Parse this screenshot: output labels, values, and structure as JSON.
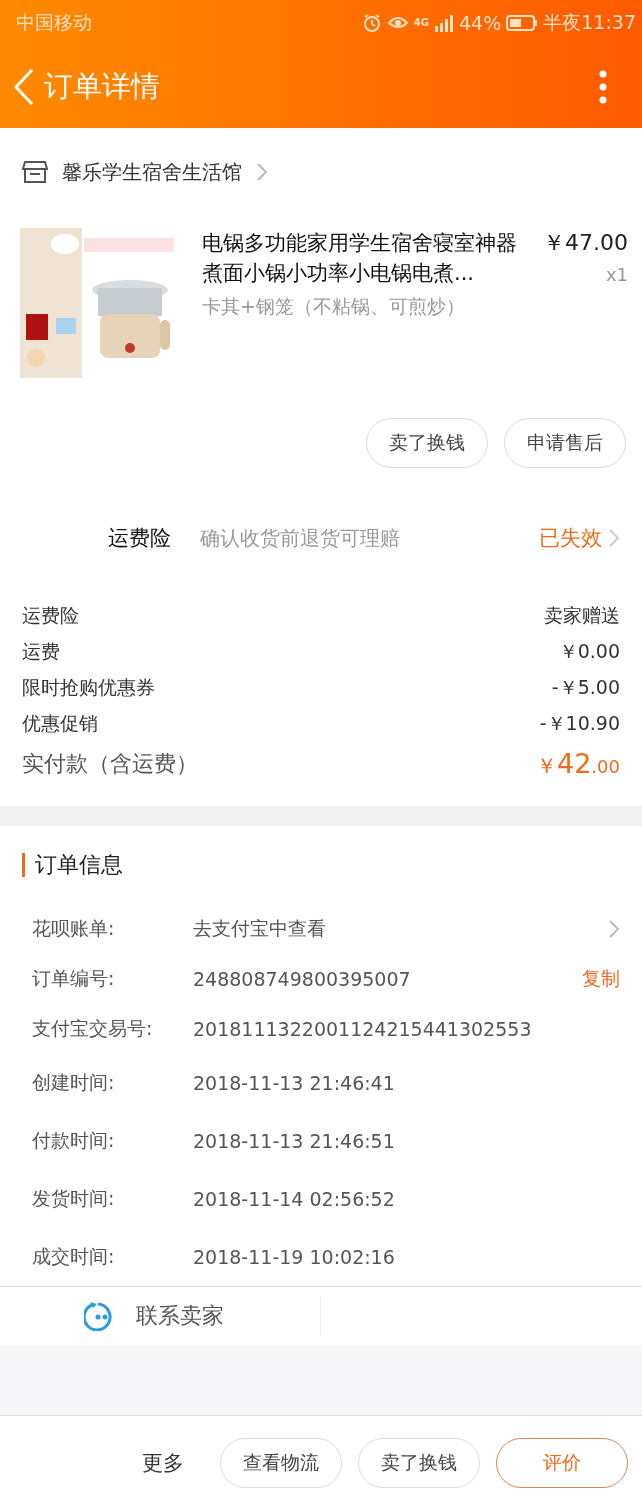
{
  "status_bar": {
    "carrier": "中国移动",
    "network": "4G",
    "battery": "44%",
    "time": "半夜11:37"
  },
  "header": {
    "title": "订单详情"
  },
  "shop": {
    "name": "馨乐学生宿舍生活馆"
  },
  "product": {
    "kind": "picture",
    "title": "电锅多功能家用学生宿舍寝室神器煮面小锅小功率小电锅电煮...",
    "price": "￥47.00",
    "quantity": "x1",
    "sku": "卡其+钢笼（不粘锅、可煎炒）"
  },
  "item_actions": [
    "卖了换钱",
    "申请售后"
  ],
  "insurance": {
    "label": "运费险",
    "description": "确认收货前退货可理赔",
    "status": "已失效"
  },
  "price_rows": [
    {
      "kind": "line",
      "label": "运费险",
      "value": "卖家赠送"
    },
    {
      "kind": "line",
      "label": "运费",
      "value": "￥0.00"
    },
    {
      "kind": "line",
      "label": "限时抢购优惠券",
      "value": "-￥5.00"
    },
    {
      "kind": "line",
      "label": "优惠促销",
      "value": "-￥10.90"
    },
    {
      "kind": "total",
      "label": "实付款（含运费）",
      "currency": "￥",
      "value": "42",
      "decimals": ".00"
    }
  ],
  "order_info": {
    "title": "订单信息",
    "rows": [
      {
        "kind": "link",
        "label": "花呗账单:",
        "value": "去支付宝中查看"
      },
      {
        "kind": "copy",
        "label": "订单编号:",
        "value": "248808749800395007",
        "action": "复制"
      },
      {
        "kind": "plain",
        "label": "支付宝交易号:",
        "value": "2018111322001124215441302553"
      },
      {
        "kind": "plain",
        "label": "创建时间:",
        "value": "2018-11-13 21:46:41"
      },
      {
        "kind": "plain",
        "label": "付款时间:",
        "value": "2018-11-13 21:46:51"
      },
      {
        "kind": "plain",
        "label": "发货时间:",
        "value": "2018-11-14 02:56:52"
      },
      {
        "kind": "plain",
        "label": "成交时间:",
        "value": "2018-11-19 10:02:16"
      }
    ]
  },
  "contact": {
    "label": "联系卖家"
  },
  "bottom_bar": {
    "more": "更多",
    "buttons": [
      {
        "kind": "normal",
        "label": "查看物流"
      },
      {
        "kind": "normal",
        "label": "卖了换钱"
      },
      {
        "kind": "primary",
        "label": "评价"
      }
    ]
  }
}
